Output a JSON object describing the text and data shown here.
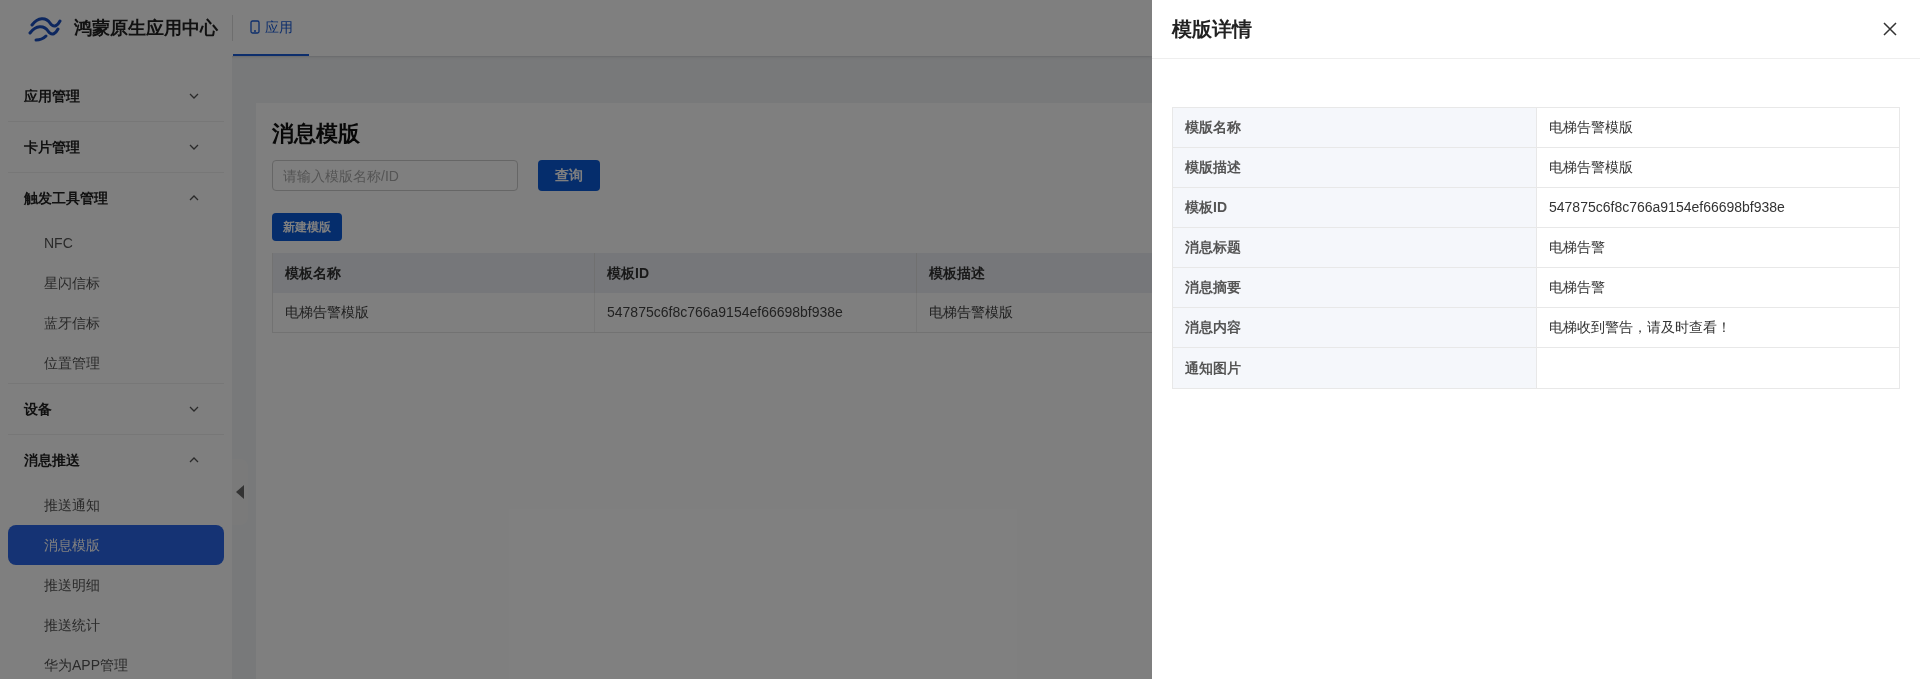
{
  "header": {
    "app_name": "鸿蒙原生应用中心",
    "tabs": [
      {
        "label": "应用",
        "selected": true
      }
    ]
  },
  "sidebar": {
    "groups": [
      {
        "label": "应用管理",
        "expanded": false
      },
      {
        "label": "卡片管理",
        "expanded": false
      },
      {
        "label": "触发工具管理",
        "expanded": true,
        "items": [
          {
            "label": "NFC",
            "selected": false
          },
          {
            "label": "星闪信标",
            "selected": false
          },
          {
            "label": "蓝牙信标",
            "selected": false
          },
          {
            "label": "位置管理",
            "selected": false
          }
        ]
      },
      {
        "label": "设备",
        "expanded": false
      },
      {
        "label": "消息推送",
        "expanded": true,
        "items": [
          {
            "label": "推送通知",
            "selected": false
          },
          {
            "label": "消息模版",
            "selected": true
          },
          {
            "label": "推送明细",
            "selected": false
          },
          {
            "label": "推送统计",
            "selected": false
          },
          {
            "label": "华为APP管理",
            "selected": false
          }
        ]
      }
    ]
  },
  "page": {
    "title": "消息模版",
    "search": {
      "placeholder": "请输入模版名称/ID"
    },
    "search_button": "查询",
    "new_button": "新建模版",
    "table": {
      "columns": [
        "模板名称",
        "模板ID",
        "模板描述"
      ],
      "rows": [
        [
          "电梯告警模版",
          "547875c6f8c766a9154ef66698bf938e",
          "电梯告警模版"
        ]
      ]
    }
  },
  "drawer": {
    "title": "模版详情",
    "fields": [
      {
        "label": "模版名称",
        "value": "电梯告警模版"
      },
      {
        "label": "模版描述",
        "value": "电梯告警模版"
      },
      {
        "label": "模板ID",
        "value": "547875c6f8c766a9154ef66698bf938e"
      },
      {
        "label": "消息标题",
        "value": "电梯告警"
      },
      {
        "label": "消息摘要",
        "value": "电梯告警"
      },
      {
        "label": "消息内容",
        "value": "电梯收到警告，请及时查看！"
      },
      {
        "label": "通知图片"
      }
    ]
  }
}
